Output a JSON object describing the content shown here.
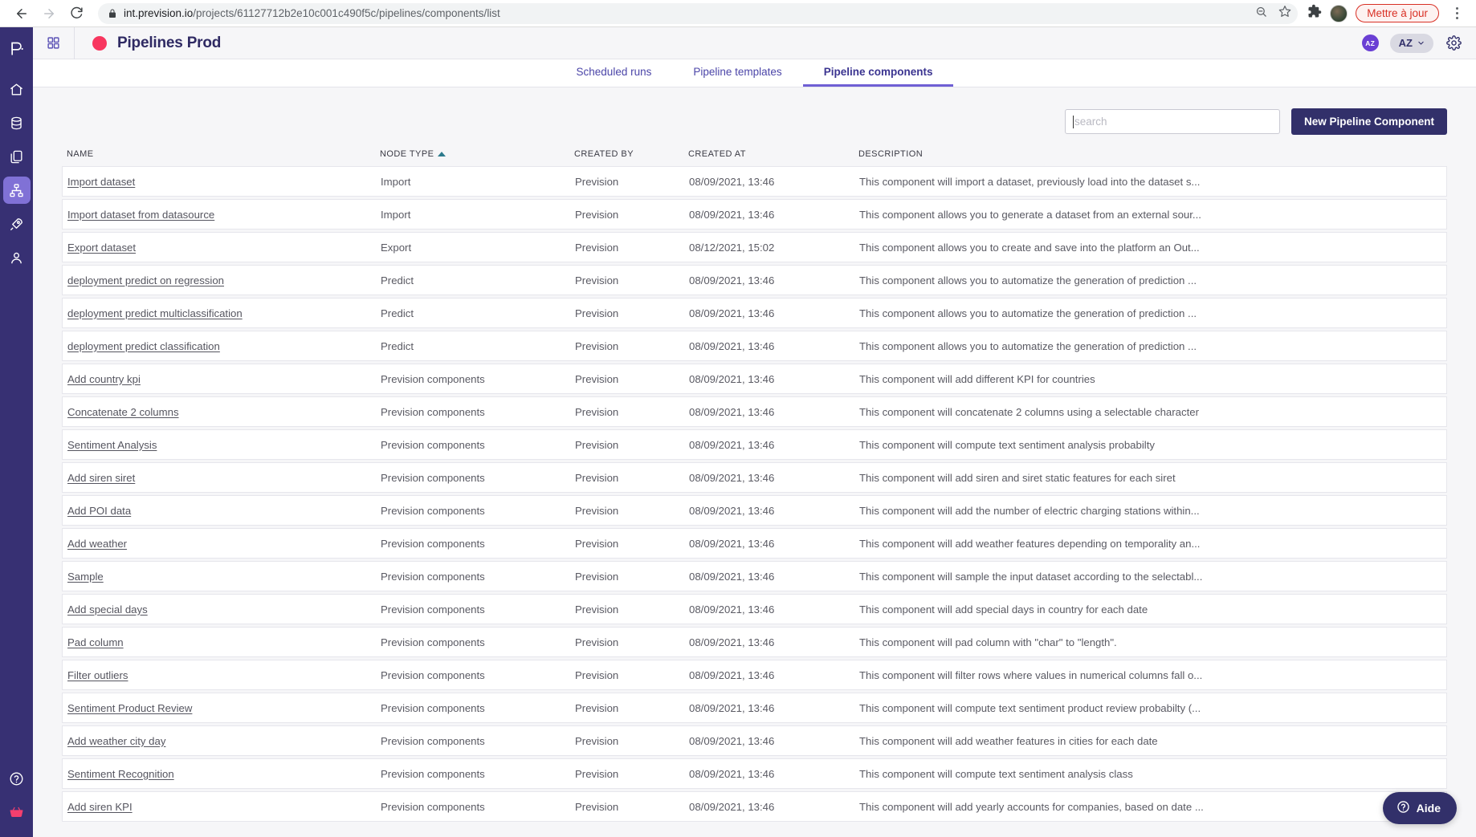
{
  "browser": {
    "back_icon": "back-arrow-icon",
    "forward_icon": "forward-arrow-icon",
    "reload_icon": "reload-icon",
    "lock_icon": "lock-icon",
    "url_host": "int.prevision.io",
    "url_path": "/projects/61127712b2e10c001c490f5c/pipelines/components/list",
    "zoom_out_icon": "zoom-out-icon",
    "bookmark_icon": "star-icon",
    "extensions_icon": "puzzle-icon",
    "profile_icon": "profile-avatar",
    "update_label": "Mettre à jour",
    "menu_icon": "kebab-menu-icon"
  },
  "sidebar": {
    "logo_label": "P.",
    "items": [
      {
        "name": "home-icon",
        "label": "Home"
      },
      {
        "name": "database-icon",
        "label": "Datasets"
      },
      {
        "name": "files-icon",
        "label": "Experiments"
      },
      {
        "name": "pipelines-icon",
        "label": "Pipelines"
      },
      {
        "name": "rocket-icon",
        "label": "Deployments"
      },
      {
        "name": "user-icon",
        "label": "Users"
      }
    ],
    "bottom": [
      {
        "name": "help-circle-icon",
        "label": "Help"
      },
      {
        "name": "basket-icon",
        "label": "Store"
      }
    ]
  },
  "header": {
    "grid_icon": "apps-grid-icon",
    "project_dot_color": "#f8365f",
    "title": "Pipelines Prod",
    "avatar_initials": "AZ",
    "account_pill": "AZ",
    "chevron_icon": "chevron-down-icon",
    "gear_icon": "gear-icon"
  },
  "tabs": [
    {
      "label": "Scheduled runs",
      "active": false
    },
    {
      "label": "Pipeline templates",
      "active": false
    },
    {
      "label": "Pipeline components",
      "active": true
    }
  ],
  "toolbar": {
    "search_placeholder": "search",
    "search_value": "",
    "new_button_label": "New Pipeline Component"
  },
  "table": {
    "columns": [
      "NAME",
      "NODE TYPE",
      "CREATED BY",
      "CREATED AT",
      "DESCRIPTION"
    ],
    "sorted_column": "NODE TYPE",
    "sort_direction": "asc",
    "rows": [
      {
        "name": "Import dataset",
        "node_type": "Import",
        "created_by": "Prevision",
        "created_at": "08/09/2021, 13:46",
        "description": "This component will import a dataset, previously load into the dataset s..."
      },
      {
        "name": "Import dataset from datasource",
        "node_type": "Import",
        "created_by": "Prevision",
        "created_at": "08/09/2021, 13:46",
        "description": "This component allows you to generate a dataset from an external sour..."
      },
      {
        "name": "Export dataset",
        "node_type": "Export",
        "created_by": "Prevision",
        "created_at": "08/12/2021, 15:02",
        "description": "This component allows you to create and save into the platform an Out..."
      },
      {
        "name": "deployment predict on regression",
        "node_type": "Predict",
        "created_by": "Prevision",
        "created_at": "08/09/2021, 13:46",
        "description": "This component allows you to automatize the generation of prediction ..."
      },
      {
        "name": "deployment predict multiclassification",
        "node_type": "Predict",
        "created_by": "Prevision",
        "created_at": "08/09/2021, 13:46",
        "description": "This component allows you to automatize the generation of prediction ..."
      },
      {
        "name": "deployment predict classification",
        "node_type": "Predict",
        "created_by": "Prevision",
        "created_at": "08/09/2021, 13:46",
        "description": "This component allows you to automatize the generation of prediction ..."
      },
      {
        "name": "Add country kpi",
        "node_type": "Prevision components",
        "created_by": "Prevision",
        "created_at": "08/09/2021, 13:46",
        "description": "This component will add different KPI for countries"
      },
      {
        "name": "Concatenate 2 columns",
        "node_type": "Prevision components",
        "created_by": "Prevision",
        "created_at": "08/09/2021, 13:46",
        "description": "This component will concatenate 2 columns using a selectable character"
      },
      {
        "name": "Sentiment Analysis",
        "node_type": "Prevision components",
        "created_by": "Prevision",
        "created_at": "08/09/2021, 13:46",
        "description": "This component will compute text sentiment analysis probabilty"
      },
      {
        "name": "Add siren siret",
        "node_type": "Prevision components",
        "created_by": "Prevision",
        "created_at": "08/09/2021, 13:46",
        "description": "This component will add siren and siret static features for each siret"
      },
      {
        "name": "Add POI data",
        "node_type": "Prevision components",
        "created_by": "Prevision",
        "created_at": "08/09/2021, 13:46",
        "description": "This component will add the number of electric charging stations within..."
      },
      {
        "name": "Add weather",
        "node_type": "Prevision components",
        "created_by": "Prevision",
        "created_at": "08/09/2021, 13:46",
        "description": "This component will add weather features depending on temporality an..."
      },
      {
        "name": "Sample",
        "node_type": "Prevision components",
        "created_by": "Prevision",
        "created_at": "08/09/2021, 13:46",
        "description": "This component will sample the input dataset according to the selectabl..."
      },
      {
        "name": "Add special days",
        "node_type": "Prevision components",
        "created_by": "Prevision",
        "created_at": "08/09/2021, 13:46",
        "description": "This component will add special days in country for each date"
      },
      {
        "name": "Pad column",
        "node_type": "Prevision components",
        "created_by": "Prevision",
        "created_at": "08/09/2021, 13:46",
        "description": "This component will pad column with \"char\" to \"length\"."
      },
      {
        "name": "Filter outliers",
        "node_type": "Prevision components",
        "created_by": "Prevision",
        "created_at": "08/09/2021, 13:46",
        "description": "This component will filter rows where values in numerical columns fall o..."
      },
      {
        "name": "Sentiment Product Review",
        "node_type": "Prevision components",
        "created_by": "Prevision",
        "created_at": "08/09/2021, 13:46",
        "description": "This component will compute text sentiment product review probabilty (..."
      },
      {
        "name": "Add weather city day",
        "node_type": "Prevision components",
        "created_by": "Prevision",
        "created_at": "08/09/2021, 13:46",
        "description": "This component will add weather features in cities for each date"
      },
      {
        "name": "Sentiment Recognition",
        "node_type": "Prevision components",
        "created_by": "Prevision",
        "created_at": "08/09/2021, 13:46",
        "description": "This component will compute text sentiment analysis class"
      },
      {
        "name": "Add siren KPI",
        "node_type": "Prevision components",
        "created_by": "Prevision",
        "created_at": "08/09/2021, 13:46",
        "description": "This component will add yearly accounts for companies, based on date ..."
      }
    ]
  },
  "help_fab": {
    "icon": "help-circle-icon",
    "label": "Aide"
  },
  "colors": {
    "sidebar_bg": "#373073",
    "accent_purple": "#6f5fd4",
    "brand_navy": "#32306a",
    "project_dot": "#f8365f",
    "update_red": "#d93025"
  }
}
